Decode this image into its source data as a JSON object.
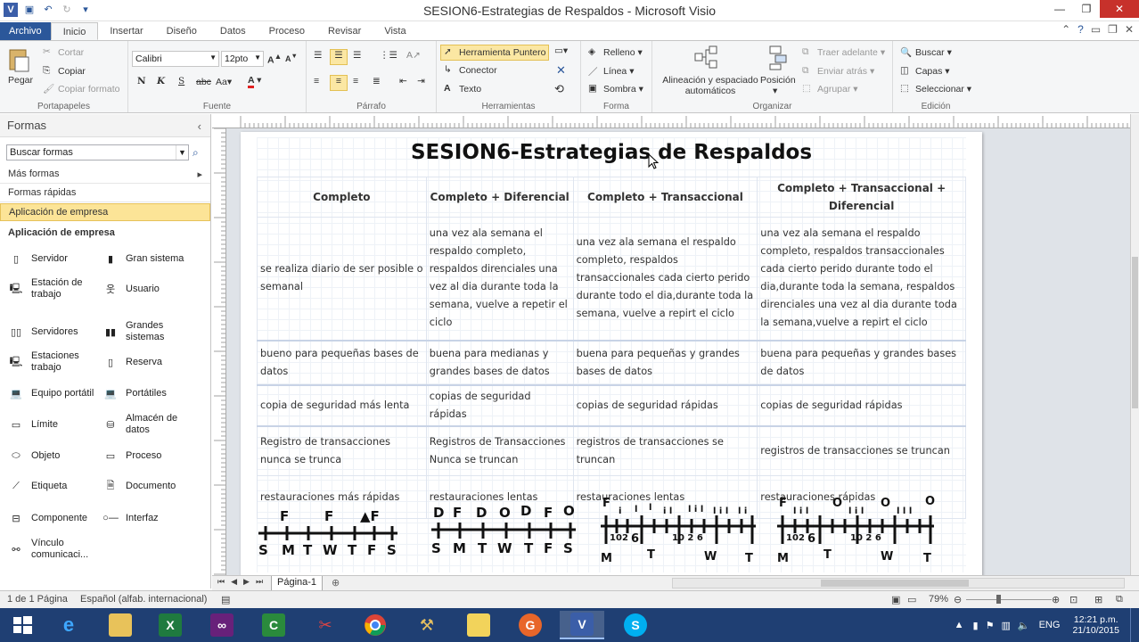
{
  "window": {
    "title": "SESION6-Estrategias de Respaldos - Microsoft Visio"
  },
  "tabs": [
    "Archivo",
    "Inicio",
    "Insertar",
    "Diseño",
    "Datos",
    "Proceso",
    "Revisar",
    "Vista"
  ],
  "ribbon": {
    "portapapeles": {
      "label": "Portapapeles",
      "pegar": "Pegar",
      "cortar": "Cortar",
      "copiar": "Copiar",
      "copiar_formato": "Copiar formato"
    },
    "fuente": {
      "label": "Fuente",
      "font": "Calibri",
      "size": "12pto"
    },
    "parrafo": {
      "label": "Párrafo"
    },
    "herramientas": {
      "label": "Herramientas",
      "puntero": "Herramienta Puntero",
      "conector": "Conector",
      "texto": "Texto"
    },
    "forma": {
      "label": "Forma",
      "relleno": "Relleno",
      "linea": "Línea",
      "sombra": "Sombra"
    },
    "organizar": {
      "label": "Organizar",
      "alineacion": "Alineación y espaciado automáticos",
      "posicion": "Posición",
      "traer_adelante": "Traer adelante",
      "enviar_atras": "Enviar atrás",
      "agrupar": "Agrupar"
    },
    "edicion": {
      "label": "Edición",
      "buscar": "Buscar",
      "capas": "Capas",
      "seleccionar": "Seleccionar"
    }
  },
  "shapes_pane": {
    "title": "Formas",
    "search_value": "Buscar formas",
    "mas_formas": "Más formas",
    "formas_rapidas": "Formas rápidas",
    "selected_stencil": "Aplicación de empresa",
    "stencil_heading": "Aplicación de empresa",
    "shapes": [
      {
        "label": "Servidor",
        "icon": "server-icon"
      },
      {
        "label": "Gran sistema",
        "icon": "mainframe-icon"
      },
      {
        "label": "Estación de trabajo",
        "icon": "workstation-icon"
      },
      {
        "label": "Usuario",
        "icon": "user-icon"
      },
      {
        "label": "Servidores",
        "icon": "servers-icon"
      },
      {
        "label": "Grandes sistemas",
        "icon": "mainframes-icon"
      },
      {
        "label": "Estaciones trabajo",
        "icon": "workstations-icon"
      },
      {
        "label": "Reserva",
        "icon": "backup-icon"
      },
      {
        "label": "Equipo portátil",
        "icon": "laptop-icon"
      },
      {
        "label": "Portátiles",
        "icon": "laptops-icon"
      },
      {
        "label": "Límite",
        "icon": "boundary-icon"
      },
      {
        "label": "Almacén de datos",
        "icon": "datastore-icon"
      },
      {
        "label": "Objeto",
        "icon": "object-icon"
      },
      {
        "label": "Proceso",
        "icon": "process-icon"
      },
      {
        "label": "Etiqueta",
        "icon": "label-icon"
      },
      {
        "label": "Documento",
        "icon": "document-icon"
      },
      {
        "label": "Componente",
        "icon": "component-icon"
      },
      {
        "label": "Interfaz",
        "icon": "interface-icon"
      },
      {
        "label": "Vínculo comunicaci...",
        "icon": "link-icon"
      }
    ]
  },
  "diagram": {
    "title": "SESION6-Estrategias de Respaldos",
    "headers": [
      "Completo",
      "Completo + Diferencial",
      "Completo + Transaccional",
      "Completo + Transaccional + Diferencial"
    ],
    "rows": [
      [
        "se realiza diario de ser posible o semanal",
        "una vez ala semana el respaldo completo, respaldos direnciales una vez al dia durante toda la semana, vuelve a repetir el ciclo",
        "una vez ala semana el respaldo completo, respaldos transaccionales cada cierto perido durante todo el dia,durante toda la semana, vuelve a repirt el ciclo",
        "una vez ala semana el respaldo completo, respaldos transaccionales cada cierto perido durante todo el dia,durante toda la semana, respaldos direnciales una vez al dia durante toda la semana,vuelve a repirt el ciclo"
      ],
      [
        "bueno para pequeñas bases de datos",
        "buena para medianas y grandes bases de datos",
        "buena para pequeñas y grandes bases de datos",
        "buena para pequeñas y grandes bases de datos"
      ],
      [
        "copia de seguridad más lenta",
        "copias de seguridad rápidas",
        "copias de seguridad rápidas",
        "copias de seguridad rápidas"
      ],
      [
        "Registro de transacciones nunca se trunca",
        "Registros de Transacciones Nunca se truncan",
        "registros de transacciones se truncan",
        "registros de transacciones se truncan"
      ],
      [
        "restauraciones más rápidas",
        "restauraciones lentas",
        "restauraciones lentas",
        "restauraciones rápidas"
      ]
    ]
  },
  "page_tab": "Página-1",
  "status": {
    "pages": "1 de 1 Página",
    "language": "Español (alfab. internacional)",
    "zoom": "79%"
  },
  "taskbar": {
    "lang": "ENG",
    "time": "12:21 p.m.",
    "date": "21/10/2015"
  }
}
